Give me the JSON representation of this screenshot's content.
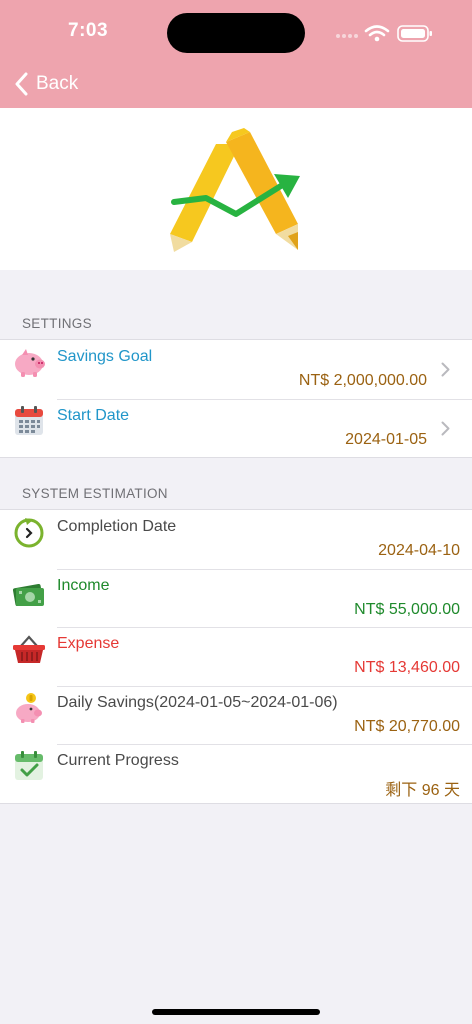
{
  "status_bar": {
    "time": "7:03"
  },
  "nav": {
    "back_label": "Back"
  },
  "settings": {
    "header": "SETTINGS",
    "items": [
      {
        "title": "Savings Goal",
        "value": "NT$ 2,000,000.00",
        "icon": "piggy-bank-icon"
      },
      {
        "title": "Start Date",
        "value": "2024-01-05",
        "icon": "calendar-icon"
      }
    ]
  },
  "estimation": {
    "header": "SYSTEM ESTIMATION",
    "items": [
      {
        "title": "Completion Date",
        "value": "2024-04-10",
        "icon": "refresh-clock-icon"
      },
      {
        "title": "Income",
        "value": "NT$ 55,000.00",
        "icon": "money-icon"
      },
      {
        "title": "Expense",
        "value": "NT$ 13,460.00",
        "icon": "basket-icon"
      },
      {
        "title": "Daily Savings(2024-01-05~2024-01-06)",
        "value": "NT$ 20,770.00",
        "icon": "piggy-coin-icon"
      },
      {
        "title": "Current Progress",
        "value": "剩下 96 天",
        "icon": "calendar-check-icon"
      }
    ]
  },
  "colors": {
    "nav_bar": "#eea4ae",
    "link_blue": "#2196c9",
    "brown_value": "#9b6212",
    "income_green": "#1f8a2c",
    "expense_red": "#e53935",
    "neutral_text": "#4a4a4a"
  }
}
